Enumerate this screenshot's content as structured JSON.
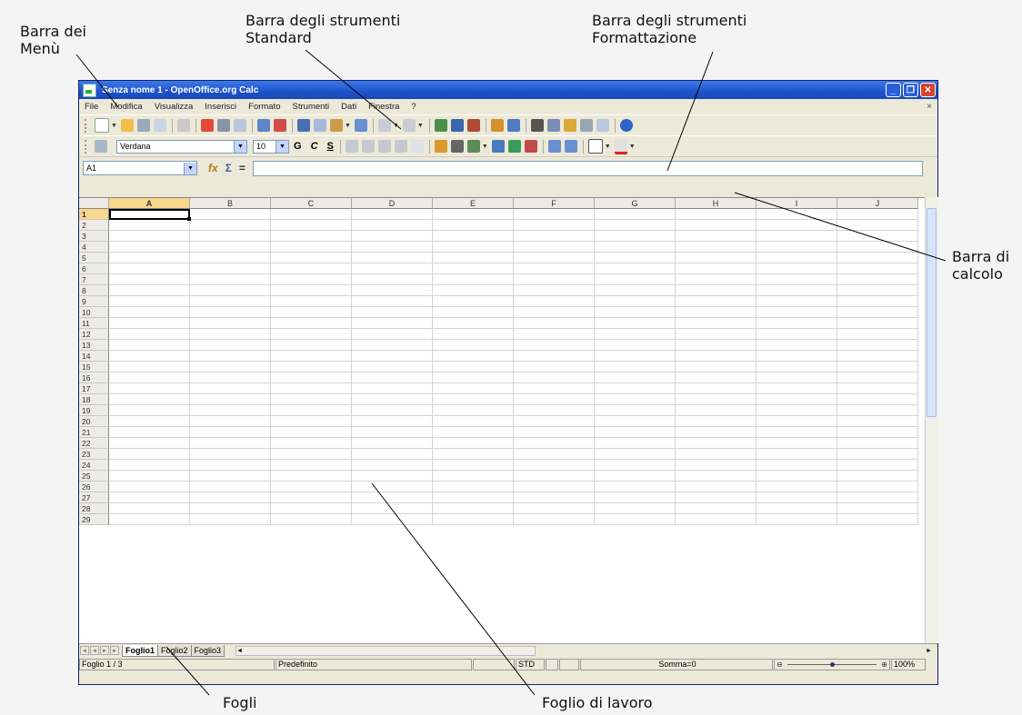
{
  "callouts": {
    "menu": "Barra dei\nMenù",
    "standard": "Barra degli strumenti\nStandard",
    "formatting": "Barra degli strumenti\nFormattazione",
    "formula": "Barra di\ncalcolo",
    "sheets": "Fogli",
    "worksheet": "Foglio di lavoro"
  },
  "window": {
    "title": "Senza nome 1 - OpenOffice.org Calc",
    "min": "_",
    "max": "❐",
    "close": "✕"
  },
  "menubar": {
    "items": [
      "File",
      "Modifica",
      "Visualizza",
      "Inserisci",
      "Formato",
      "Strumenti",
      "Dati",
      "Finestra",
      "?"
    ],
    "doc_close": "×"
  },
  "format_toolbar": {
    "font_name": "Verdana",
    "font_size": "10",
    "bold": "G",
    "italic": "C",
    "underline": "S"
  },
  "formula_bar": {
    "name_box": "A1",
    "function_wizard": "fx",
    "sum": "Σ",
    "equals": "="
  },
  "sheet": {
    "columns": [
      "A",
      "B",
      "C",
      "D",
      "E",
      "F",
      "G",
      "H",
      "I",
      "J"
    ],
    "active_column": "A",
    "active_row": 1,
    "row_count": 29
  },
  "tabs": {
    "sheets": [
      "Foglio1",
      "Foglio2",
      "Foglio3"
    ],
    "active": "Foglio1"
  },
  "status": {
    "sheet_info": "Foglio 1 / 3",
    "page_style": "Predefinito",
    "insert_mode": "STD",
    "sum": "Somma=0",
    "zoom": "100%",
    "zoom_level": 0.5
  },
  "colors": {
    "title_bar": "#1d53c9",
    "active_header": "#f8d68c",
    "close_button": "#d5452c"
  }
}
